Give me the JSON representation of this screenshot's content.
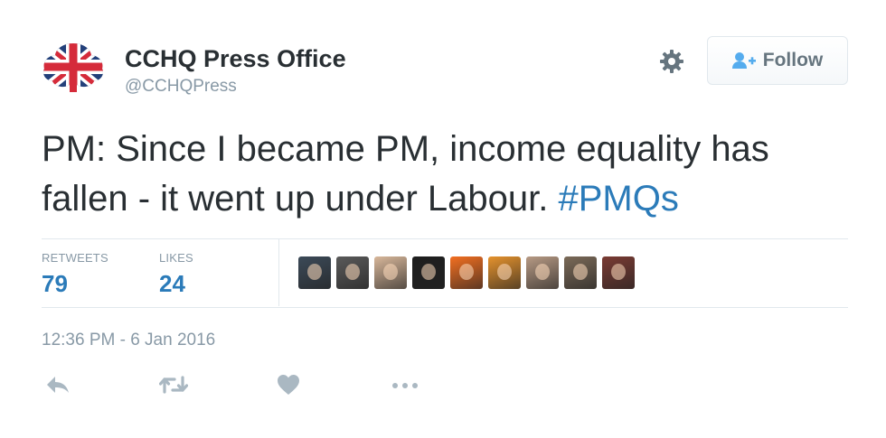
{
  "user": {
    "display_name": "CCHQ Press Office",
    "handle": "@CCHQPress",
    "avatar_icon": "conservative-tree-union-jack-logo"
  },
  "header": {
    "settings_icon": "gear-icon",
    "follow_label": "Follow",
    "follow_icon": "add-user-icon"
  },
  "tweet": {
    "text": "PM: Since I became PM, income equality has fallen - it went up under Labour.",
    "hashtag": "#PMQs"
  },
  "stats": {
    "retweets_label": "RETWEETS",
    "retweets_count": "79",
    "likes_label": "LIKES",
    "likes_count": "24"
  },
  "likers": [
    {
      "name": "liker-avatar-1",
      "color": "#3c4a58"
    },
    {
      "name": "liker-avatar-2",
      "color": "#5a5a5a"
    },
    {
      "name": "liker-avatar-3",
      "color": "#d8b79a"
    },
    {
      "name": "liker-avatar-4",
      "color": "#1e1e1e"
    },
    {
      "name": "liker-avatar-5",
      "color": "#f36f21"
    },
    {
      "name": "liker-avatar-6",
      "color": "#e5922d"
    },
    {
      "name": "liker-avatar-7",
      "color": "#b79a84"
    },
    {
      "name": "liker-avatar-8",
      "color": "#7b6a58"
    },
    {
      "name": "liker-avatar-9",
      "color": "#7a3b33"
    }
  ],
  "timestamp": "12:36 PM - 6 Jan 2016",
  "actions": [
    "reply-icon",
    "retweet-icon",
    "like-heart-icon",
    "more-dots-icon"
  ],
  "colors": {
    "link_blue": "#2b7bb9",
    "muted_gray": "#8899a6",
    "text_dark": "#292f33",
    "action_gray": "#aab8c2"
  }
}
